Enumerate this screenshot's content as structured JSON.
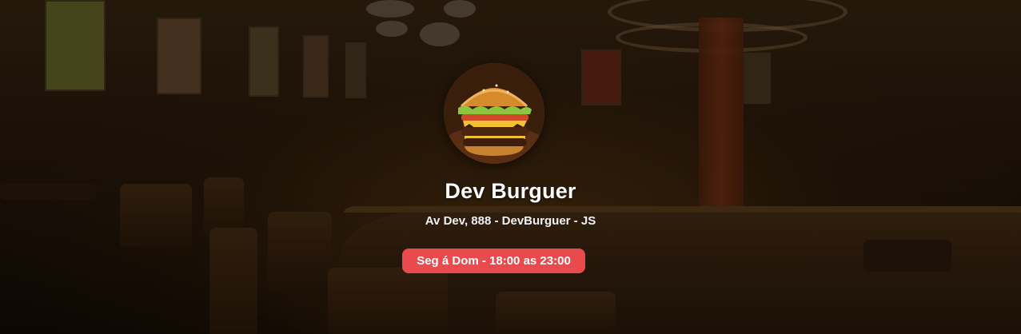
{
  "restaurant": {
    "name": "Dev Burguer",
    "address": "Av Dev, 888 - DevBurguer - JS",
    "hours": "Seg á Dom - 18:00 as 23:00"
  },
  "colors": {
    "hours_badge": "#e84a4e",
    "text": "#ffffff",
    "overlay": "#000000"
  },
  "icons": {
    "logo": "burger-logo-image",
    "background": "restaurant-interior-image"
  }
}
